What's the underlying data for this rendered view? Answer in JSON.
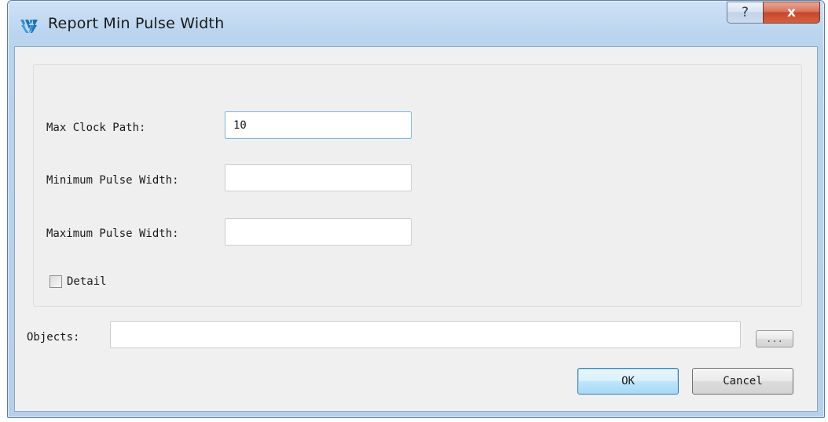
{
  "window": {
    "title": "Report Min Pulse Width",
    "help_glyph": "?",
    "close_glyph": "x"
  },
  "form": {
    "max_clock_path": {
      "label": "Max Clock Path:",
      "value": "10"
    },
    "min_pulse_width": {
      "label": "Minimum Pulse Width:",
      "value": ""
    },
    "max_pulse_width": {
      "label": "Maximum Pulse Width:",
      "value": ""
    },
    "detail": {
      "label": "Detail",
      "checked": false
    }
  },
  "objects": {
    "label": "Objects:",
    "value": "",
    "browse_label": "..."
  },
  "buttons": {
    "ok": "OK",
    "cancel": "Cancel"
  },
  "colors": {
    "accent_focus": "#7eb4ea",
    "close_red": "#c5472c",
    "title_blue": "#bcd5ef"
  }
}
